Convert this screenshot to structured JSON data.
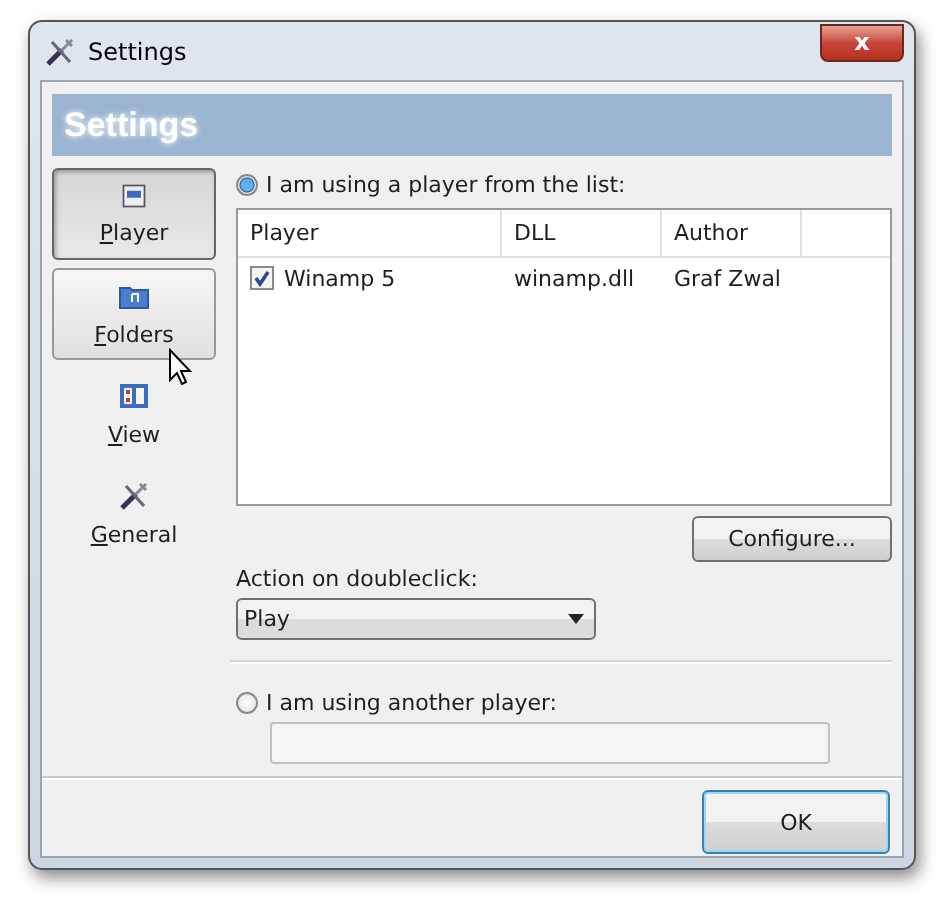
{
  "window": {
    "title": "Settings",
    "close_button": "x"
  },
  "header": {
    "title": "Settings"
  },
  "sidebar": {
    "items": [
      {
        "label": "Player",
        "selected": true,
        "hovered": false
      },
      {
        "label": "Folders",
        "selected": false,
        "hovered": true
      },
      {
        "label": "View",
        "selected": false,
        "hovered": false
      },
      {
        "label": "General",
        "selected": false,
        "hovered": false
      }
    ]
  },
  "player_list_option": {
    "label": "I am using a player from the list:",
    "selected": true
  },
  "table": {
    "columns": [
      "Player",
      "DLL",
      "Author"
    ],
    "rows": [
      {
        "cells": [
          "Winamp 5",
          "winamp.dll",
          "Graf Zwal"
        ],
        "checked": true
      }
    ]
  },
  "configure_button": "Configure...",
  "action": {
    "label": "Action on doubleclick:",
    "value": "Play"
  },
  "other_player_option": {
    "label": "I am using another player:",
    "selected": false
  },
  "ok_button": "OK"
}
